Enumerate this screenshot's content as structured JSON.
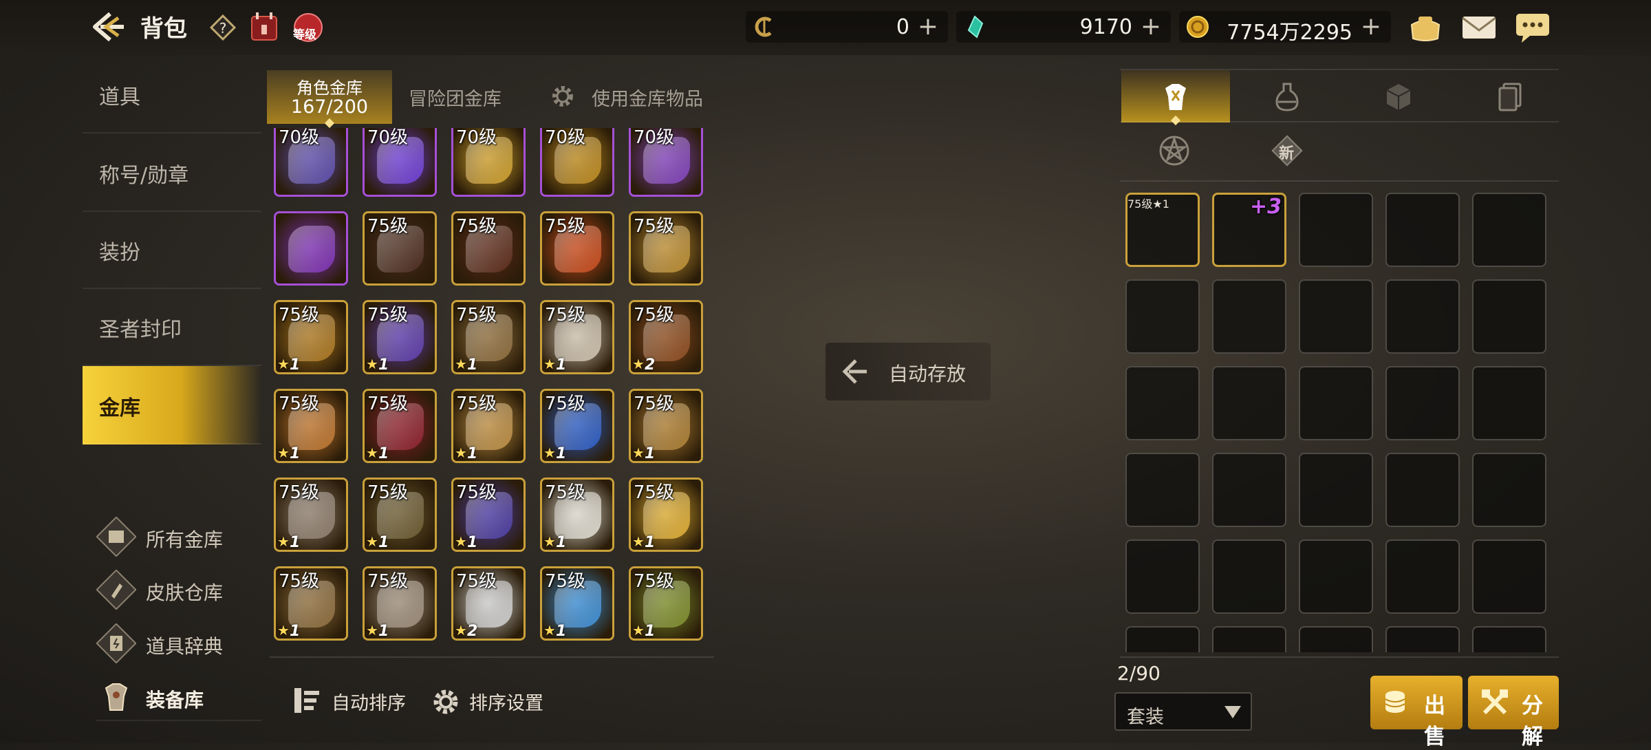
{
  "header": {
    "title": "背包",
    "currencies": [
      {
        "icon": "c-coin-icon",
        "value": "0"
      },
      {
        "icon": "green-crystal-icon",
        "value": "9170"
      },
      {
        "icon": "gold-coin-icon",
        "value": "7754万2295"
      }
    ],
    "level_badge": "等级"
  },
  "sidebar": {
    "items": [
      {
        "label": "道具"
      },
      {
        "label": "称号/勋章"
      },
      {
        "label": "装扮"
      },
      {
        "label": "圣者封印"
      },
      {
        "label": "金库",
        "active": true
      }
    ],
    "sub_items": [
      {
        "label": "所有金库",
        "icon": "vault-icon"
      },
      {
        "label": "皮肤仓库",
        "icon": "brush-icon"
      },
      {
        "label": "道具辞典",
        "icon": "book-icon"
      },
      {
        "label": "装备库",
        "icon": "armor-icon",
        "active": true
      }
    ]
  },
  "tabs": {
    "character_vault": {
      "label": "角色金库",
      "count": "167/200"
    },
    "adventure_vault": "冒险团金库",
    "use_vault_items": "使用金库物品"
  },
  "grid": {
    "rows": [
      [
        {
          "lv": "70级",
          "c": "#5a4aa8"
        },
        {
          "lv": "70级",
          "c": "#6a3bd0"
        },
        {
          "lv": "70级",
          "c": "#c89a2a"
        },
        {
          "lv": "70级",
          "c": "#b8861c"
        },
        {
          "lv": "70级",
          "c": "#7d3fb6"
        }
      ],
      [
        {
          "lv": "",
          "c": "#7a2fb0"
        },
        {
          "lv": "75级",
          "c": "#4a2a1e"
        },
        {
          "lv": "75级",
          "c": "#5a2a1a"
        },
        {
          "lv": "75级",
          "c": "#c4481a"
        },
        {
          "lv": "75级",
          "c": "#b88a30"
        }
      ],
      [
        {
          "lv": "75级",
          "n": "1",
          "c": "#a8741e"
        },
        {
          "lv": "75级",
          "n": "1",
          "c": "#5a3aa8"
        },
        {
          "lv": "75级",
          "n": "1",
          "c": "#8a6a3a"
        },
        {
          "lv": "75级",
          "n": "1",
          "c": "#c8bca8"
        },
        {
          "lv": "75级",
          "n": "2",
          "c": "#8a4a1e"
        }
      ],
      [
        {
          "lv": "75级",
          "n": "1",
          "c": "#b8702a"
        },
        {
          "lv": "75级",
          "n": "1",
          "c": "#8a1e2a"
        },
        {
          "lv": "75级",
          "n": "1",
          "c": "#b88a40"
        },
        {
          "lv": "75级",
          "n": "1",
          "c": "#2a5ac0"
        },
        {
          "lv": "75级",
          "n": "1",
          "c": "#a87a30"
        }
      ],
      [
        {
          "lv": "75级",
          "n": "1",
          "c": "#8a7a6a"
        },
        {
          "lv": "75级",
          "n": "1",
          "c": "#6a5a30"
        },
        {
          "lv": "75级",
          "n": "1",
          "c": "#4a3aa0"
        },
        {
          "lv": "75级",
          "n": "1",
          "c": "#d8d4ca"
        },
        {
          "lv": "75级",
          "n": "1",
          "c": "#d8a830"
        }
      ],
      [
        {
          "lv": "75级",
          "n": "1",
          "c": "#8a6a3a"
        },
        {
          "lv": "75级",
          "n": "1",
          "c": "#9a8a78"
        },
        {
          "lv": "75级",
          "n": "2",
          "c": "#c8c8c8"
        },
        {
          "lv": "75级",
          "n": "1",
          "c": "#3a8ad0"
        },
        {
          "lv": "75级",
          "n": "1",
          "c": "#7a8a2a"
        }
      ]
    ]
  },
  "auto_store": "自动存放",
  "bottom_actions": {
    "auto_sort": "自动排序",
    "sort_settings": "排序设置"
  },
  "right_panel": {
    "tab_icons": [
      "armor-tab-icon",
      "potion-tab-icon",
      "cube-tab-icon",
      "cards-tab-icon"
    ],
    "sub_icons": [
      "pentagram-icon",
      "new-badge-icon"
    ],
    "new_badge": "新",
    "inventory": [
      {
        "lv": "75级",
        "n": "1",
        "c": "#2a6a5a"
      },
      {
        "lv": "",
        "plus": "+3",
        "c": "#5a4aa8"
      }
    ],
    "capacity": "2/90",
    "filter": "套装",
    "sell_label": "出售",
    "dismantle_label": "分解"
  },
  "colors": {
    "accent_gold": "#d8a81c",
    "purple_rarity": "#a650d8"
  }
}
